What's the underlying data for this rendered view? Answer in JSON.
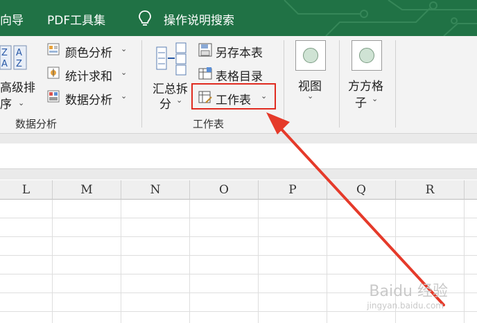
{
  "menu": {
    "items": [
      {
        "label": "向导"
      },
      {
        "label": "PDF工具集"
      },
      {
        "label": "操作说明搜索"
      }
    ]
  },
  "ribbon": {
    "sort_button": {
      "line1": "高级排",
      "line2": "序"
    },
    "data_analysis_items": [
      {
        "label": "颜色分析"
      },
      {
        "label": "统计求和"
      },
      {
        "label": "数据分析"
      }
    ],
    "data_analysis_group": "数据分析",
    "summarize_button": {
      "line1": "汇总拆",
      "line2": "分"
    },
    "worksheet_items": [
      {
        "label": "另存本表"
      },
      {
        "label": "表格目录"
      },
      {
        "label": "工作表"
      }
    ],
    "worksheet_group": "工作表",
    "view_button": {
      "label": "视图"
    },
    "grid_button": {
      "line1": "方方格",
      "line2": "子"
    }
  },
  "sheet": {
    "columns": [
      "L",
      "M",
      "N",
      "O",
      "P",
      "Q",
      "R"
    ]
  },
  "watermark": {
    "main": "Baidu 经验",
    "sub": "jingyan.baidu.com"
  },
  "colors": {
    "title_green": "#207245",
    "highlight_red": "#e02b20",
    "arrow_red": "#e53a2a"
  }
}
